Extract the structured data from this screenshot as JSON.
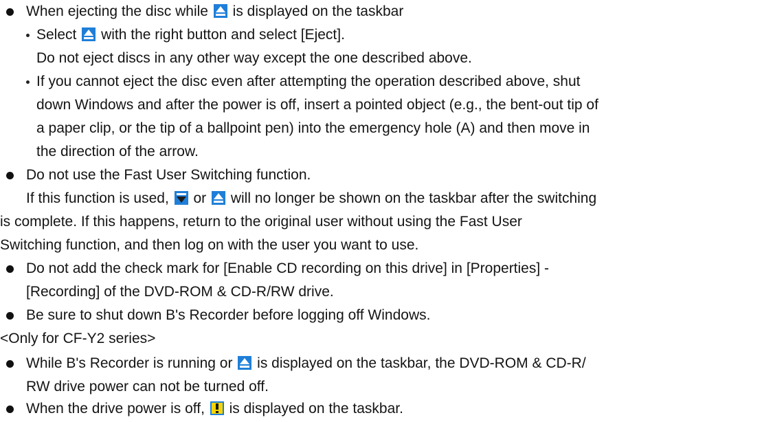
{
  "bullets": {
    "b1": "When ejecting the disc while",
    "b1_end": "is displayed on the taskbar",
    "s1a": "Select",
    "s1a_end": "with the right button and select [Eject].",
    "s1b": "Do not eject discs in any other way except the one described above.",
    "s2_l1": "If you cannot eject the disc even after attempting the operation described above, shut",
    "s2_l2": "down Windows and after the power is off, insert a pointed object (e.g., the bent-out tip of",
    "s2_l3": "a paper clip, or the tip of a ballpoint pen) into the emergency hole (A) and then move in",
    "s2_l4": "the direction of the arrow.",
    "b2": "Do not use the Fast User Switching function.",
    "b2_p_start": "If this function is used,",
    "b2_p_or": "or",
    "b2_p_end": "will no longer be shown on the taskbar after the switching",
    "b2_l2": "is complete. If this happens, return to the original user without using the Fast User",
    "b2_l3": "Switching function, and then log on with the user you want to use.",
    "b3_l1": "Do not add the check mark for [Enable CD recording on this drive] in [Properties] -",
    "b3_l2": "[Recording] of the DVD-ROM & CD-R/RW drive.",
    "b4": "Be sure to shut down B's Recorder before logging off Windows.",
    "note": "<Only for CF-Y2 series>",
    "b5_start": "While B's Recorder is running or",
    "b5_end": "is displayed on the taskbar, the DVD-ROM & CD-R/",
    "b5_l2": "RW drive power can not be turned off.",
    "b6_start": "When the drive power is off,",
    "b6_end": "is displayed on the taskbar."
  },
  "icons": {
    "eject": "eject-icon",
    "drive": "drive-down-icon",
    "power_off": "drive-power-off-icon"
  },
  "colors": {
    "icon_blue": "#1f7fd8",
    "icon_yellow": "#f5d400"
  }
}
